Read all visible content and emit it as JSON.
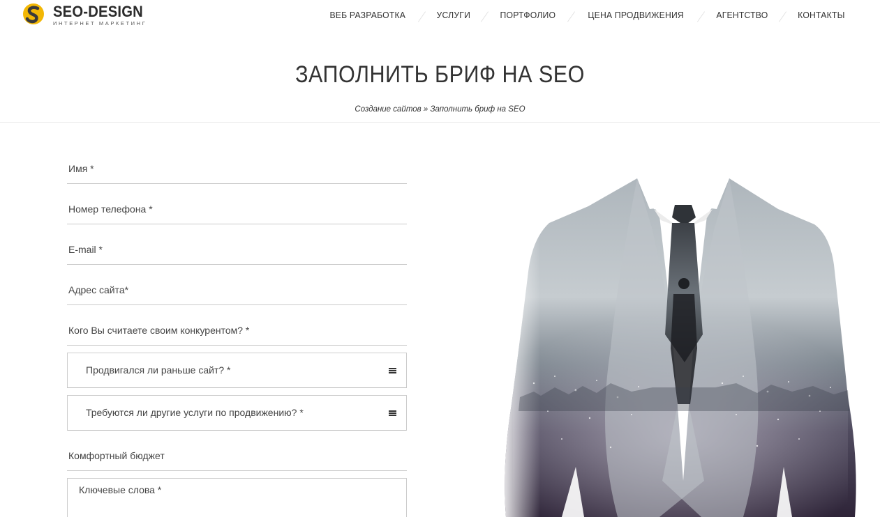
{
  "header": {
    "logo_title": "SEO-DESIGN",
    "logo_subtitle": "ИНТЕРНЕТ МАРКЕТИНГ",
    "nav": [
      {
        "label": "ВЕБ РАЗРАБОТКА"
      },
      {
        "label": "УСЛУГИ"
      },
      {
        "label": "ПОРТФОЛИО"
      },
      {
        "label": "ЦЕНА ПРОДВИЖЕНИЯ"
      },
      {
        "label": "АГЕНТСТВО"
      },
      {
        "label": "КОНТАКТЫ"
      }
    ]
  },
  "page": {
    "title": "ЗАПОЛНИТЬ БРИФ НА SEO",
    "breadcrumb": "Создание сайтов » Заполнить бриф на SEO"
  },
  "form": {
    "name": "Имя *",
    "phone": "Номер телефона *",
    "email": "E-mail *",
    "site": "Адрес сайта*",
    "competitor": "Кого Вы считаете своим конкурентом? *",
    "promoted": "Продвигался ли раньше сайт? *",
    "services": "Требуются ли другие услуги по продвижению? *",
    "budget": "Комфортный бюджет",
    "keywords": "Ключевые слова *"
  },
  "colors": {
    "logo_yellow": "#f2b705",
    "logo_dark": "#333333",
    "text": "#333333"
  },
  "icons": {
    "logo": "seo-design-s-logo-icon",
    "select": "hamburger-menu-icon"
  }
}
